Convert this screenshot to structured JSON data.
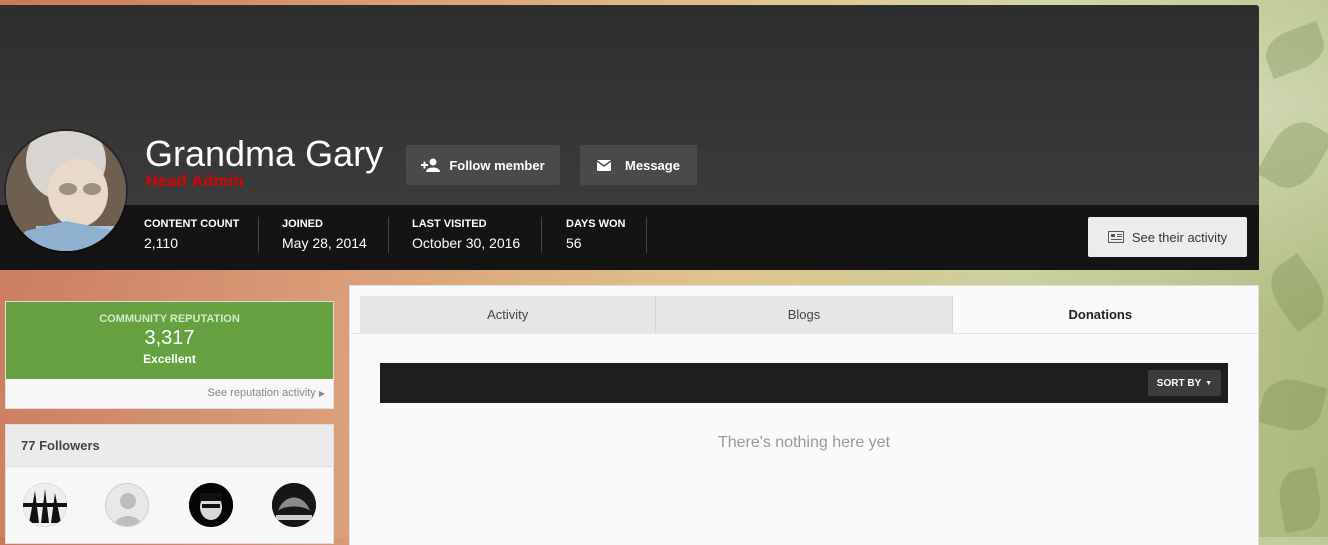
{
  "profile": {
    "name": "Grandma Gary",
    "role": "Head Admin",
    "role_color": "#e00000",
    "follow_label": "Follow member",
    "message_label": "Message",
    "activity_label": "See their activity"
  },
  "stats": [
    {
      "label": "Content Count",
      "value": "2,110"
    },
    {
      "label": "Joined",
      "value": "May 28, 2014"
    },
    {
      "label": "Last Visited",
      "value": "October 30, 2016"
    },
    {
      "label": "Days Won",
      "value": "56"
    }
  ],
  "reputation": {
    "title": "Community Reputation",
    "value": "3,317",
    "level": "Excellent",
    "link": "See reputation activity",
    "color": "#65a140"
  },
  "followers": {
    "title": "77 Followers"
  },
  "tabs": [
    {
      "label": "Activity"
    },
    {
      "label": "Blogs"
    },
    {
      "label": "Donations"
    }
  ],
  "content": {
    "sort_label": "Sort By",
    "empty_message": "There's nothing here yet"
  }
}
